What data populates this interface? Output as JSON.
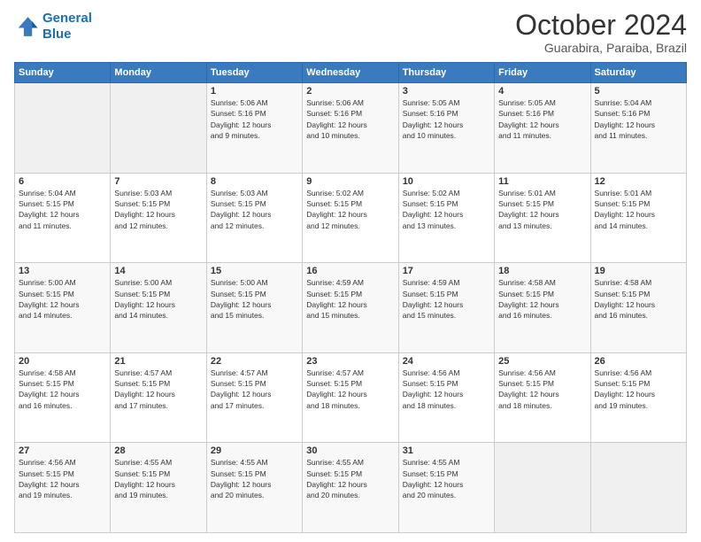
{
  "logo": {
    "line1": "General",
    "line2": "Blue"
  },
  "title": "October 2024",
  "subtitle": "Guarabira, Paraiba, Brazil",
  "headers": [
    "Sunday",
    "Monday",
    "Tuesday",
    "Wednesday",
    "Thursday",
    "Friday",
    "Saturday"
  ],
  "weeks": [
    [
      {
        "day": "",
        "detail": ""
      },
      {
        "day": "",
        "detail": ""
      },
      {
        "day": "1",
        "detail": "Sunrise: 5:06 AM\nSunset: 5:16 PM\nDaylight: 12 hours\nand 9 minutes."
      },
      {
        "day": "2",
        "detail": "Sunrise: 5:06 AM\nSunset: 5:16 PM\nDaylight: 12 hours\nand 10 minutes."
      },
      {
        "day": "3",
        "detail": "Sunrise: 5:05 AM\nSunset: 5:16 PM\nDaylight: 12 hours\nand 10 minutes."
      },
      {
        "day": "4",
        "detail": "Sunrise: 5:05 AM\nSunset: 5:16 PM\nDaylight: 12 hours\nand 11 minutes."
      },
      {
        "day": "5",
        "detail": "Sunrise: 5:04 AM\nSunset: 5:16 PM\nDaylight: 12 hours\nand 11 minutes."
      }
    ],
    [
      {
        "day": "6",
        "detail": "Sunrise: 5:04 AM\nSunset: 5:15 PM\nDaylight: 12 hours\nand 11 minutes."
      },
      {
        "day": "7",
        "detail": "Sunrise: 5:03 AM\nSunset: 5:15 PM\nDaylight: 12 hours\nand 12 minutes."
      },
      {
        "day": "8",
        "detail": "Sunrise: 5:03 AM\nSunset: 5:15 PM\nDaylight: 12 hours\nand 12 minutes."
      },
      {
        "day": "9",
        "detail": "Sunrise: 5:02 AM\nSunset: 5:15 PM\nDaylight: 12 hours\nand 12 minutes."
      },
      {
        "day": "10",
        "detail": "Sunrise: 5:02 AM\nSunset: 5:15 PM\nDaylight: 12 hours\nand 13 minutes."
      },
      {
        "day": "11",
        "detail": "Sunrise: 5:01 AM\nSunset: 5:15 PM\nDaylight: 12 hours\nand 13 minutes."
      },
      {
        "day": "12",
        "detail": "Sunrise: 5:01 AM\nSunset: 5:15 PM\nDaylight: 12 hours\nand 14 minutes."
      }
    ],
    [
      {
        "day": "13",
        "detail": "Sunrise: 5:00 AM\nSunset: 5:15 PM\nDaylight: 12 hours\nand 14 minutes."
      },
      {
        "day": "14",
        "detail": "Sunrise: 5:00 AM\nSunset: 5:15 PM\nDaylight: 12 hours\nand 14 minutes."
      },
      {
        "day": "15",
        "detail": "Sunrise: 5:00 AM\nSunset: 5:15 PM\nDaylight: 12 hours\nand 15 minutes."
      },
      {
        "day": "16",
        "detail": "Sunrise: 4:59 AM\nSunset: 5:15 PM\nDaylight: 12 hours\nand 15 minutes."
      },
      {
        "day": "17",
        "detail": "Sunrise: 4:59 AM\nSunset: 5:15 PM\nDaylight: 12 hours\nand 15 minutes."
      },
      {
        "day": "18",
        "detail": "Sunrise: 4:58 AM\nSunset: 5:15 PM\nDaylight: 12 hours\nand 16 minutes."
      },
      {
        "day": "19",
        "detail": "Sunrise: 4:58 AM\nSunset: 5:15 PM\nDaylight: 12 hours\nand 16 minutes."
      }
    ],
    [
      {
        "day": "20",
        "detail": "Sunrise: 4:58 AM\nSunset: 5:15 PM\nDaylight: 12 hours\nand 16 minutes."
      },
      {
        "day": "21",
        "detail": "Sunrise: 4:57 AM\nSunset: 5:15 PM\nDaylight: 12 hours\nand 17 minutes."
      },
      {
        "day": "22",
        "detail": "Sunrise: 4:57 AM\nSunset: 5:15 PM\nDaylight: 12 hours\nand 17 minutes."
      },
      {
        "day": "23",
        "detail": "Sunrise: 4:57 AM\nSunset: 5:15 PM\nDaylight: 12 hours\nand 18 minutes."
      },
      {
        "day": "24",
        "detail": "Sunrise: 4:56 AM\nSunset: 5:15 PM\nDaylight: 12 hours\nand 18 minutes."
      },
      {
        "day": "25",
        "detail": "Sunrise: 4:56 AM\nSunset: 5:15 PM\nDaylight: 12 hours\nand 18 minutes."
      },
      {
        "day": "26",
        "detail": "Sunrise: 4:56 AM\nSunset: 5:15 PM\nDaylight: 12 hours\nand 19 minutes."
      }
    ],
    [
      {
        "day": "27",
        "detail": "Sunrise: 4:56 AM\nSunset: 5:15 PM\nDaylight: 12 hours\nand 19 minutes."
      },
      {
        "day": "28",
        "detail": "Sunrise: 4:55 AM\nSunset: 5:15 PM\nDaylight: 12 hours\nand 19 minutes."
      },
      {
        "day": "29",
        "detail": "Sunrise: 4:55 AM\nSunset: 5:15 PM\nDaylight: 12 hours\nand 20 minutes."
      },
      {
        "day": "30",
        "detail": "Sunrise: 4:55 AM\nSunset: 5:15 PM\nDaylight: 12 hours\nand 20 minutes."
      },
      {
        "day": "31",
        "detail": "Sunrise: 4:55 AM\nSunset: 5:15 PM\nDaylight: 12 hours\nand 20 minutes."
      },
      {
        "day": "",
        "detail": ""
      },
      {
        "day": "",
        "detail": ""
      }
    ]
  ]
}
